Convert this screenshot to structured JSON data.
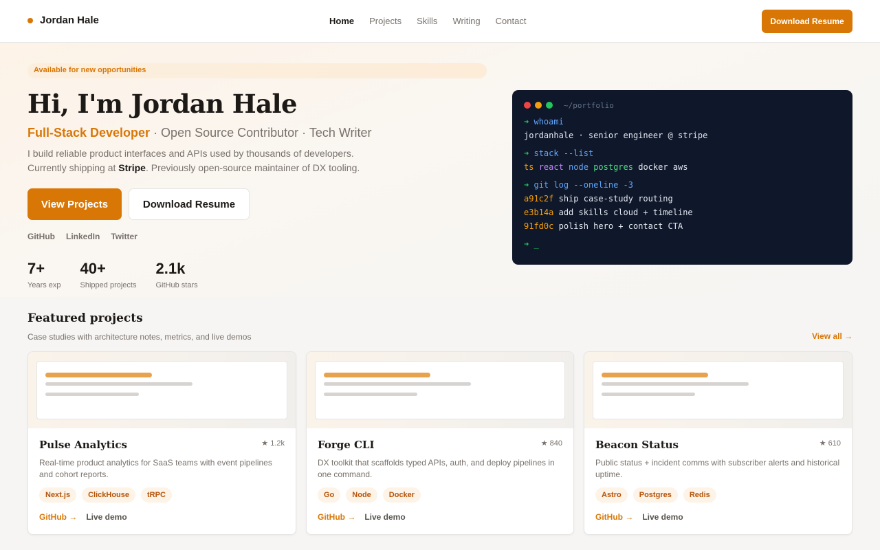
{
  "nav": {
    "brand": "Jordan Hale",
    "links": [
      "Home",
      "Projects",
      "Skills",
      "Writing",
      "Contact"
    ],
    "cta": "Download Resume"
  },
  "hero": {
    "badge": "Available for new opportunities",
    "title": "Hi, I'm Jordan Hale",
    "role": "Full-Stack Developer",
    "role_rest": " · Open Source Contributor · Tech Writer",
    "desc_line1": "I build reliable product interfaces and APIs used by thousands of developers.",
    "desc_line2_pre": "Currently shipping at ",
    "desc_company": "Stripe",
    "desc_line2_post": ". Previously open-source maintainer of DX tooling.",
    "primary_button": "View Projects",
    "secondary_button": "Download Resume",
    "socials": [
      "GitHub",
      "LinkedIn",
      "Twitter"
    ],
    "stats": [
      {
        "value": "7+",
        "label": "Years exp"
      },
      {
        "value": "40+",
        "label": "Shipped projects"
      },
      {
        "value": "2.1k",
        "label": "GitHub stars"
      }
    ]
  },
  "terminal": {
    "path": "~/portfolio",
    "prompt": "➜",
    "cmd1": "whoami",
    "out1": "jordanhale · senior engineer @ stripe",
    "cmd2": "stack --list",
    "stack": [
      {
        "text": "ts",
        "color": "#f59e0b"
      },
      {
        "text": "react",
        "color": "#c084fc"
      },
      {
        "text": "node",
        "color": "#60a5fa"
      },
      {
        "text": "postgres",
        "color": "#4ade80"
      },
      {
        "text": "docker",
        "color": "#e2e8f0"
      },
      {
        "text": "aws",
        "color": "#e2e8f0"
      }
    ],
    "cmd3": "git log --oneline -3",
    "commits": [
      {
        "hash": "a91c2f",
        "msg": "ship case-study routing"
      },
      {
        "hash": "e3b14a",
        "msg": "add skills cloud + timeline"
      },
      {
        "hash": "91fd0c",
        "msg": "polish hero + contact CTA"
      }
    ],
    "cursor": "_"
  },
  "featured": {
    "title": "Featured projects",
    "subtitle": "Case studies with architecture notes, metrics, and live demos",
    "view_all": "View all →",
    "projects": [
      {
        "title": "Pulse Analytics",
        "stars": "★ 1.2k",
        "desc": "Real-time product analytics for SaaS teams with event pipelines and cohort reports.",
        "tags": [
          "Next.js",
          "ClickHouse",
          "tRPC"
        ],
        "github": "GitHub →",
        "live": "Live demo"
      },
      {
        "title": "Forge CLI",
        "stars": "★ 840",
        "desc": "DX toolkit that scaffolds typed APIs, auth, and deploy pipelines in one command.",
        "tags": [
          "Go",
          "Node",
          "Docker"
        ],
        "github": "GitHub →",
        "live": "Live demo"
      },
      {
        "title": "Beacon Status",
        "stars": "★ 610",
        "desc": "Public status + incident comms with subscriber alerts and historical uptime.",
        "tags": [
          "Astro",
          "Postgres",
          "Redis"
        ],
        "github": "GitHub →",
        "live": "Live demo"
      }
    ]
  },
  "colors": {
    "accent": "#d97706",
    "terminal_bg": "#0f172a",
    "dot_red": "#ef4444",
    "dot_yellow": "#f59e0b",
    "dot_green": "#22c55e"
  }
}
